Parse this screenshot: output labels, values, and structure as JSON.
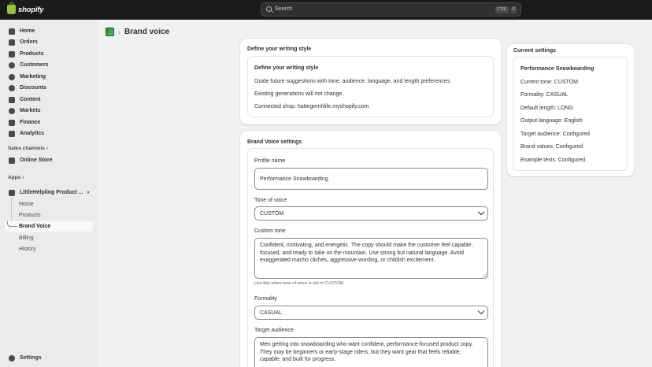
{
  "topbar": {
    "logo_text": "shopify",
    "search_placeholder": "Search",
    "shortcut_key1": "CTRL",
    "shortcut_key2": "K"
  },
  "sidebar": {
    "main_items": [
      {
        "label": "Home",
        "icon": "home-icon"
      },
      {
        "label": "Orders",
        "icon": "orders-icon"
      },
      {
        "label": "Products",
        "icon": "tag-icon"
      },
      {
        "label": "Customers",
        "icon": "person-icon"
      },
      {
        "label": "Marketing",
        "icon": "target-icon"
      },
      {
        "label": "Discounts",
        "icon": "discount-icon"
      },
      {
        "label": "Content",
        "icon": "content-icon"
      },
      {
        "label": "Markets",
        "icon": "globe-icon"
      },
      {
        "label": "Finance",
        "icon": "bank-icon"
      },
      {
        "label": "Analytics",
        "icon": "chart-icon"
      }
    ],
    "sales_channels_label": "Sales channels",
    "online_store_label": "Online Store",
    "apps_label": "Apps",
    "app_name": "LittleHelpling Product ...",
    "app_sub_items": [
      "Home",
      "Products",
      "Brand Voice",
      "Billing",
      "History"
    ],
    "active_sub_item": "Brand Voice",
    "settings_label": "Settings"
  },
  "page": {
    "title": "Brand voice"
  },
  "writing_style_card": {
    "heading": "Define your writing style",
    "inner_title": "Define your writing style",
    "description": "Guide future suggestions with tone, audience, language, and length preferences.",
    "note": "Existing generations will not change.",
    "connected_shop": "Connected shop: hattegernhlife.myshopify.com"
  },
  "brand_voice_settings": {
    "heading": "Brand Voice settings",
    "profile_name_label": "Profile name",
    "profile_name_value": "Performance Snowboarding",
    "tone_label": "Tone of voice",
    "tone_value": "CUSTOM",
    "custom_tone_label": "Custom tone",
    "custom_tone_value": "Confident, motivating, and energetic. The copy should make the customer feel capable, focused, and ready to take on the mountain. Use strong but natural language. Avoid exaggerated macho clichés, aggressive wording, or childish excitement.",
    "custom_tone_help": "Use this when tone of voice is set to CUSTOM.",
    "formality_label": "Formality",
    "formality_value": "CASUAL",
    "target_audience_label": "Target audience",
    "target_audience_value": "Men getting into snowboarding who want confident, performance-focused product copy. They may be beginners or early-stage riders, but they want gear that feels reliable, capable, and built for progress."
  },
  "current_settings": {
    "heading": "Current settings",
    "profile": "Performance Snowboarding",
    "lines": [
      "Current tone: CUSTOM",
      "Formality: CASUAL",
      "Default length: LONG",
      "Output language: English",
      "Target audience: Configured",
      "Brand values: Configured",
      "Example texts: Configured"
    ]
  },
  "colors": {
    "topbar_bg": "#1a1a1a",
    "sidebar_bg": "#ebebeb",
    "page_bg": "#f1f1f1",
    "card_bg": "#ffffff",
    "brand_green": "#95bf47"
  }
}
